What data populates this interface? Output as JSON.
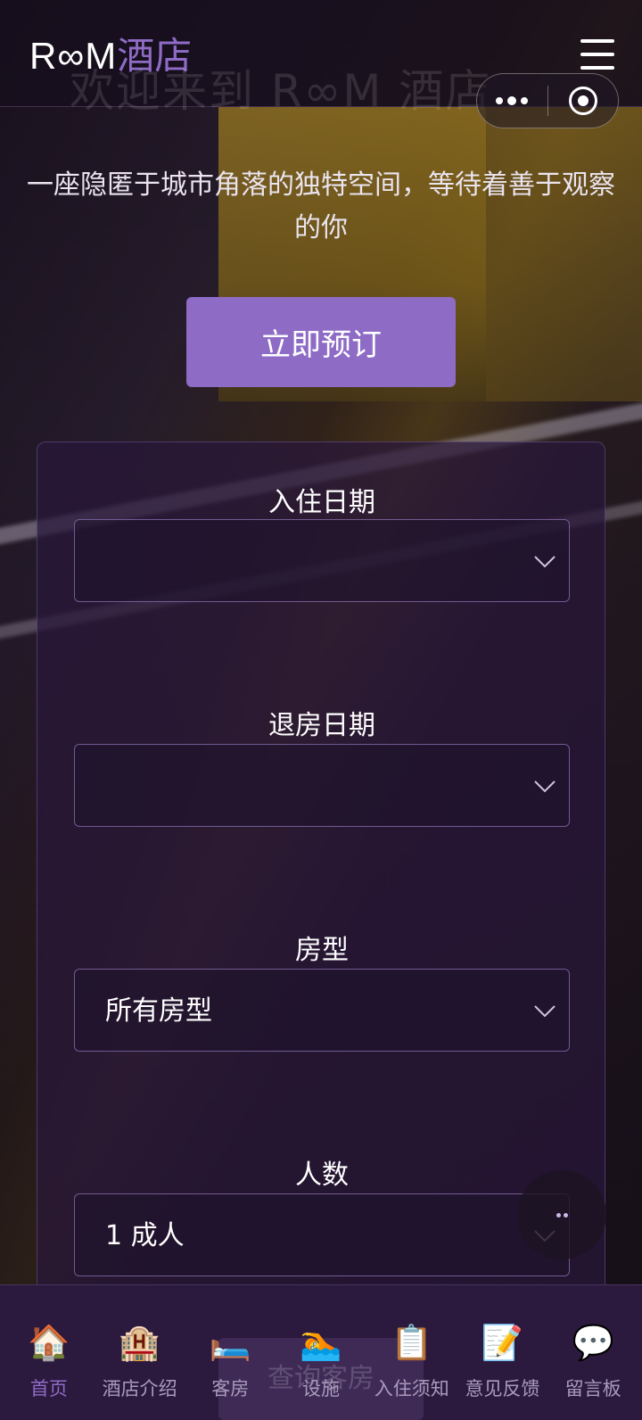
{
  "header": {
    "logo_en": "R∞M",
    "logo_zh": "酒店",
    "bg_title": "欢迎来到 R∞M 酒店"
  },
  "hero": {
    "subtitle": "一座隐匿于城市角落的独特空间，等待着善于观察的你",
    "book_button": "立即预订"
  },
  "booking": {
    "checkin_label": "入住日期",
    "checkin_value": "",
    "checkout_label": "退房日期",
    "checkout_value": "",
    "roomtype_label": "房型",
    "roomtype_value": "所有房型",
    "guests_label": "人数",
    "guests_value": "1 成人",
    "search_button": "查询客房"
  },
  "nav": [
    {
      "label": "首页",
      "icon": "🏠",
      "icon_name": "home-icon",
      "active": true
    },
    {
      "label": "酒店介绍",
      "icon": "🏨",
      "icon_name": "hotel-icon",
      "active": false
    },
    {
      "label": "客房",
      "icon": "🛏️",
      "icon_name": "bed-icon",
      "active": false
    },
    {
      "label": "设施",
      "icon": "🏊",
      "icon_name": "swimmer-icon",
      "active": false
    },
    {
      "label": "入住须知",
      "icon": "📋",
      "icon_name": "clipboard-icon",
      "active": false
    },
    {
      "label": "意见反馈",
      "icon": "📝",
      "icon_name": "memo-icon",
      "active": false
    },
    {
      "label": "留言板",
      "icon": "💬",
      "icon_name": "speech-bubble-icon",
      "active": false
    }
  ],
  "colors": {
    "accent": "#8e6cc6",
    "nav_bg": "#2c1a3e"
  }
}
